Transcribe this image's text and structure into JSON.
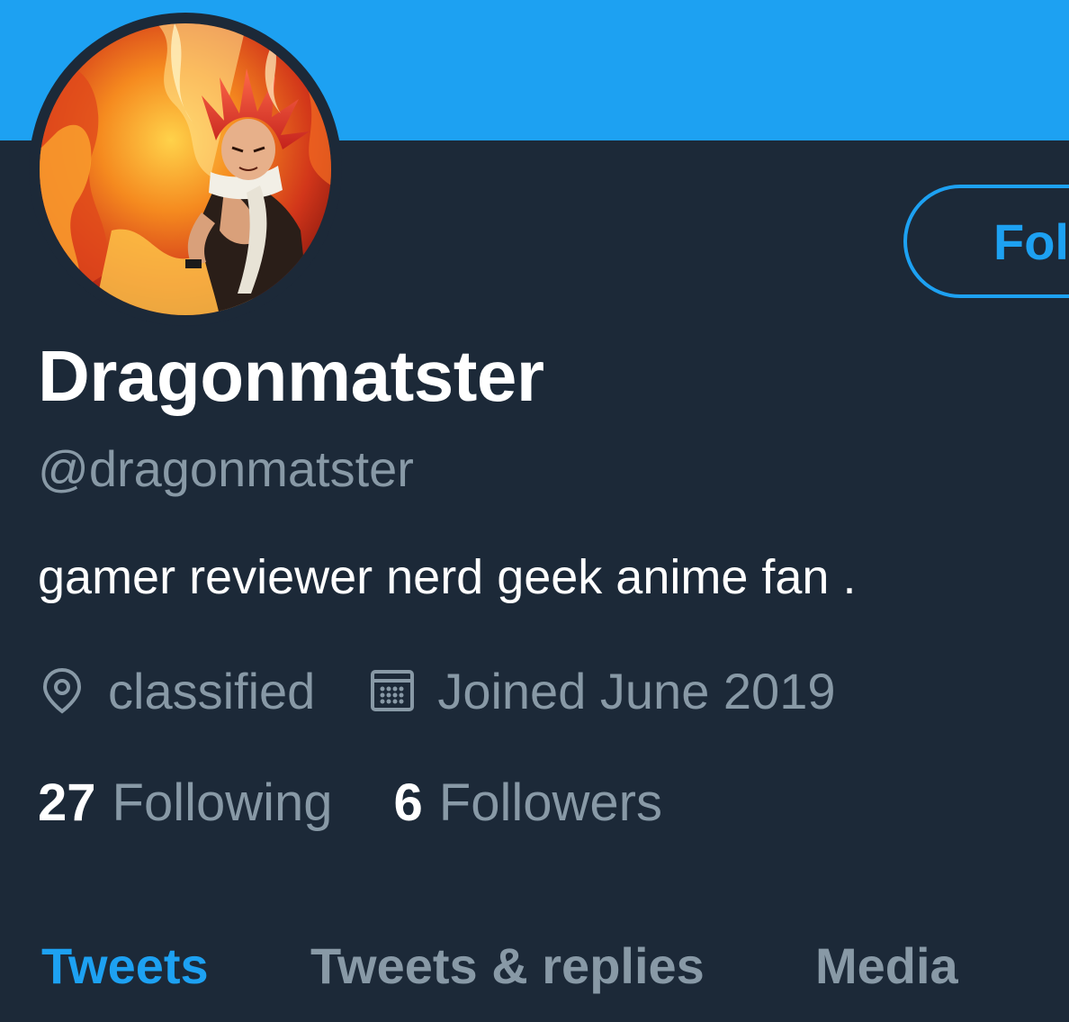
{
  "colors": {
    "banner": "#1da1f2",
    "background": "#1c2938",
    "accent": "#1da1f2",
    "primary_text": "#ffffff",
    "secondary_text": "#8899a6"
  },
  "profile": {
    "display_name": "Dragonmatster",
    "handle": "@dragonmatster",
    "bio": "gamer reviewer nerd geek anime fan .",
    "location": "classified",
    "joined": "Joined June 2019",
    "avatar_alt": "anime character with red spiky hair in flames"
  },
  "follow_button": {
    "label": "Fol"
  },
  "stats": {
    "following_count": "27",
    "following_label": "Following",
    "followers_count": "6",
    "followers_label": "Followers"
  },
  "tabs": [
    {
      "label": "Tweets",
      "active": true
    },
    {
      "label": "Tweets & replies",
      "active": false
    },
    {
      "label": "Media",
      "active": false
    }
  ],
  "icons": {
    "location": "location-pin-icon",
    "joined": "calendar-icon"
  }
}
